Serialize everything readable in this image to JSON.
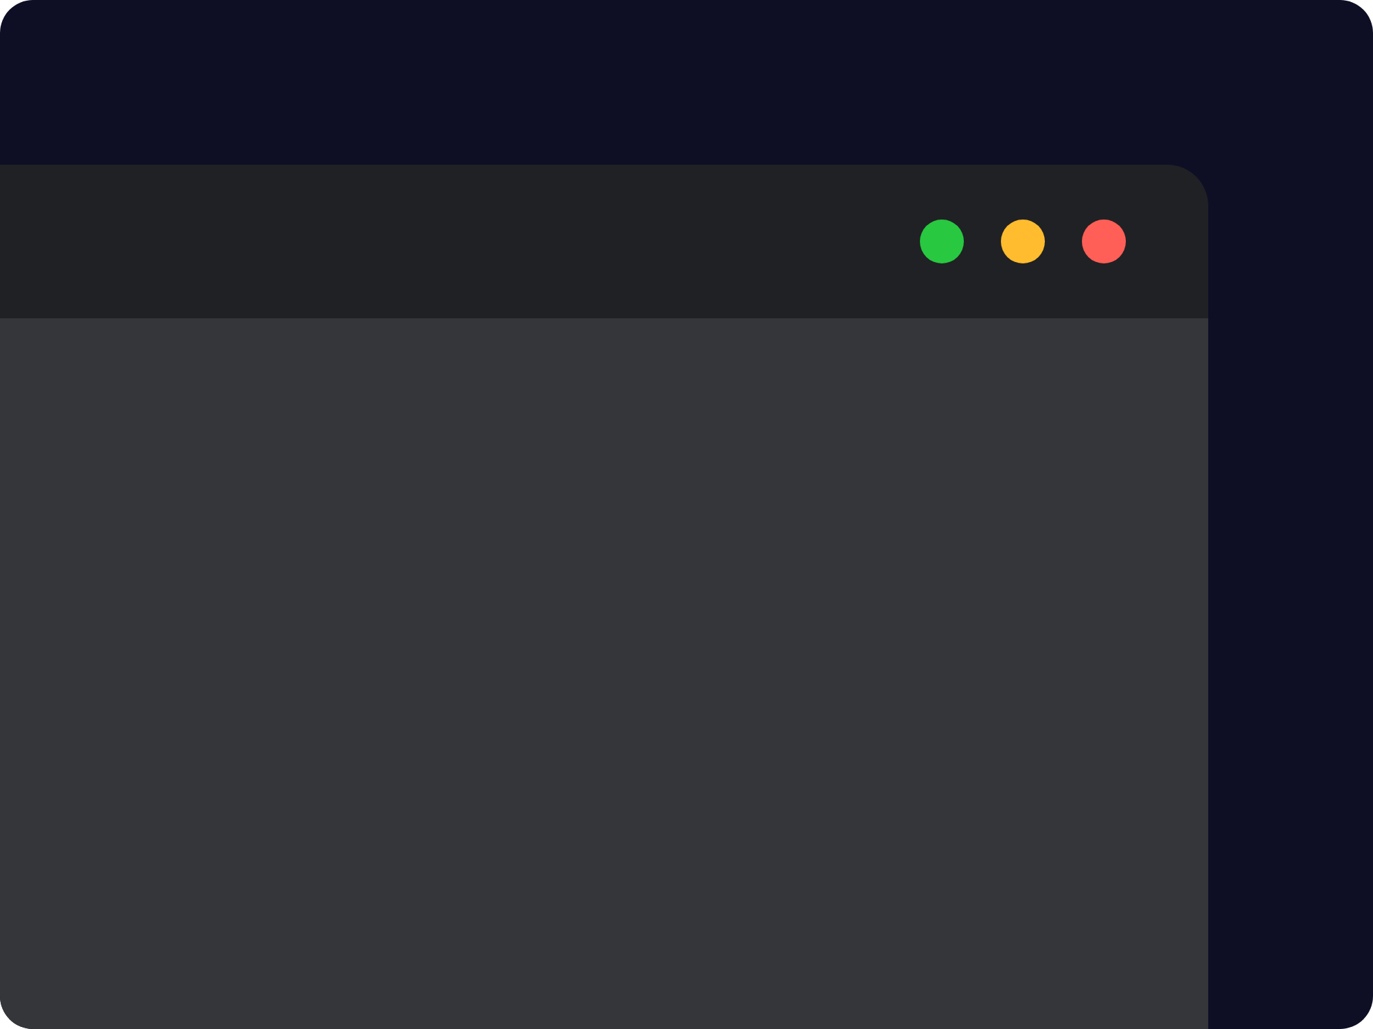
{
  "window": {
    "controls": [
      {
        "color": "#28c840"
      },
      {
        "color": "#febc2e"
      },
      {
        "color": "#ff5f57"
      }
    ]
  }
}
